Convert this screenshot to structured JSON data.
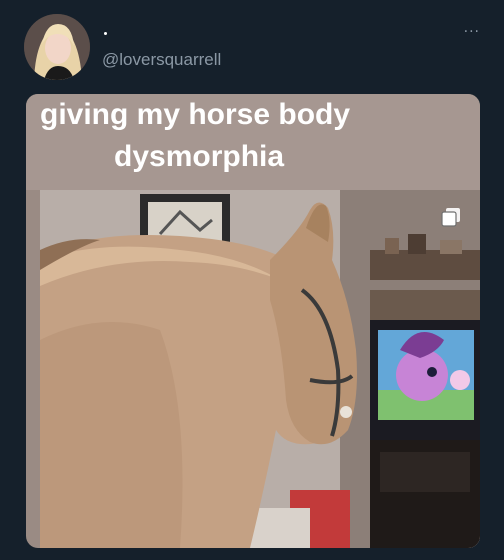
{
  "tweet": {
    "display_name": "·",
    "handle": "@loversquarrell",
    "more_icon": "more-horizontal-icon",
    "more_label": "···"
  },
  "media": {
    "caption_line1": "giving my horse body",
    "caption_line2": "dysmorphia",
    "gallery_icon": "multiple-images-icon"
  },
  "colors": {
    "background": "#15202b",
    "handle": "#8b98a5",
    "caption_text": "#ffffff"
  }
}
